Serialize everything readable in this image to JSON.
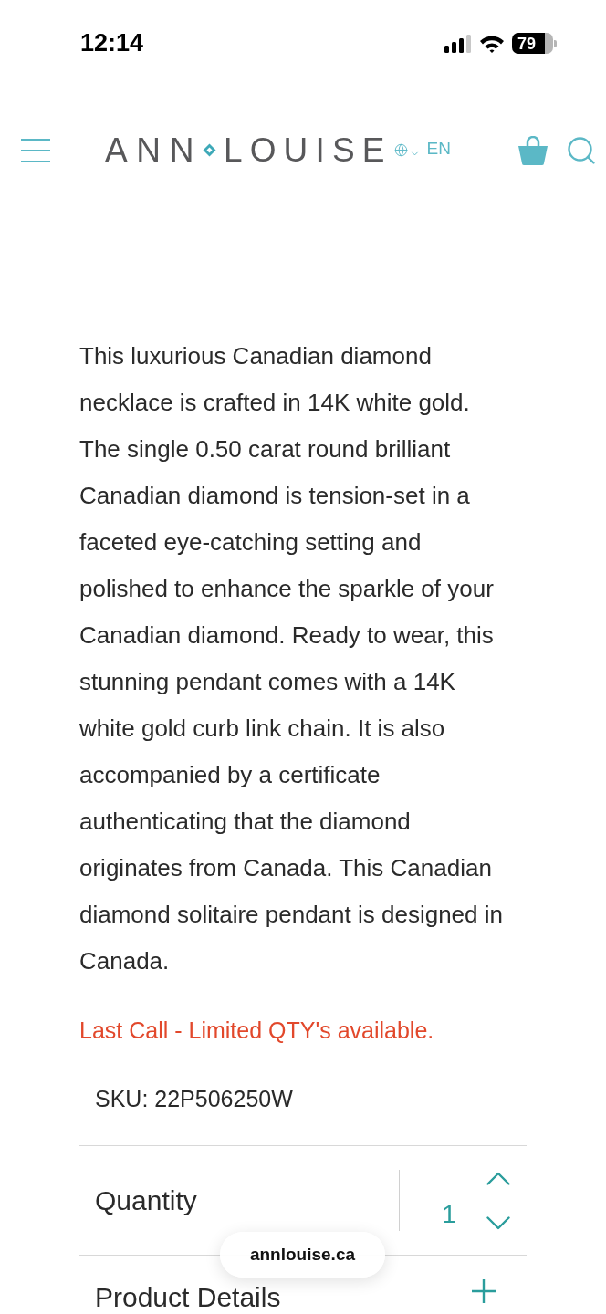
{
  "status_bar": {
    "time": "12:14",
    "battery": "79"
  },
  "header": {
    "logo": {
      "left": "ANN",
      "right": "LOUISE"
    },
    "language": "EN"
  },
  "description": "This luxurious Canadian diamond necklace is crafted in 14K white gold. The single 0.50 carat round brilliant Canadian diamond is tension-set in a faceted eye-catching setting and polished to enhance the sparkle of your Canadian diamond. Ready to wear, this stunning pendant comes with a 14K white gold curb link chain. It is also accompanied by a certificate authenticating that the diamond originates from Canada. This Canadian diamond solitaire pendant is designed in Canada.",
  "notice": "Last Call - Limited QTY's available.",
  "sku": "SKU: 22P506250W",
  "quantity": {
    "label": "Quantity",
    "value": "1"
  },
  "sections": [
    {
      "title": "Product Details",
      "expanded": false
    }
  ],
  "url_pill": "annlouise.ca"
}
